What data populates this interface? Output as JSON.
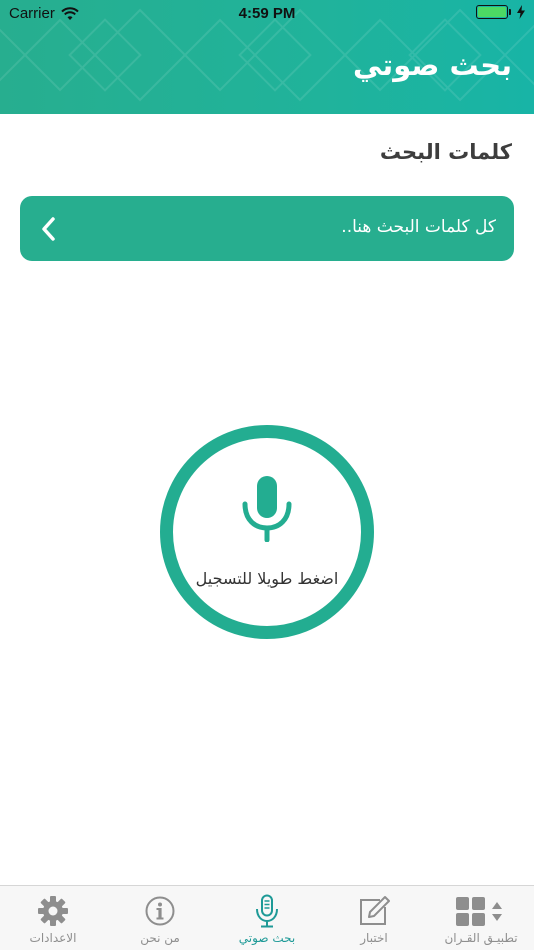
{
  "status_bar": {
    "carrier": "Carrier",
    "time": "4:59 PM"
  },
  "header": {
    "title": "بحث صوتي"
  },
  "section": {
    "title": "كلمات البحث"
  },
  "search_words": {
    "placeholder": "كل كلمات البحث هنا.."
  },
  "record": {
    "label": "اضغط طويلا للتسجيل"
  },
  "tabs": [
    {
      "label": "الاعدادات",
      "icon": "gear-icon",
      "active": false
    },
    {
      "label": "من نحن",
      "icon": "info-icon",
      "active": false
    },
    {
      "label": "بحث صوتي",
      "icon": "microphone-icon",
      "active": true
    },
    {
      "label": "اختبار",
      "icon": "edit-icon",
      "active": false
    },
    {
      "label": "تطبيـق القـران",
      "icon": "apps-icon",
      "active": false
    }
  ],
  "colors": {
    "primary": "#27ae8f",
    "active_tab": "#1e9a97",
    "inactive_tab": "#8e8e8e"
  }
}
